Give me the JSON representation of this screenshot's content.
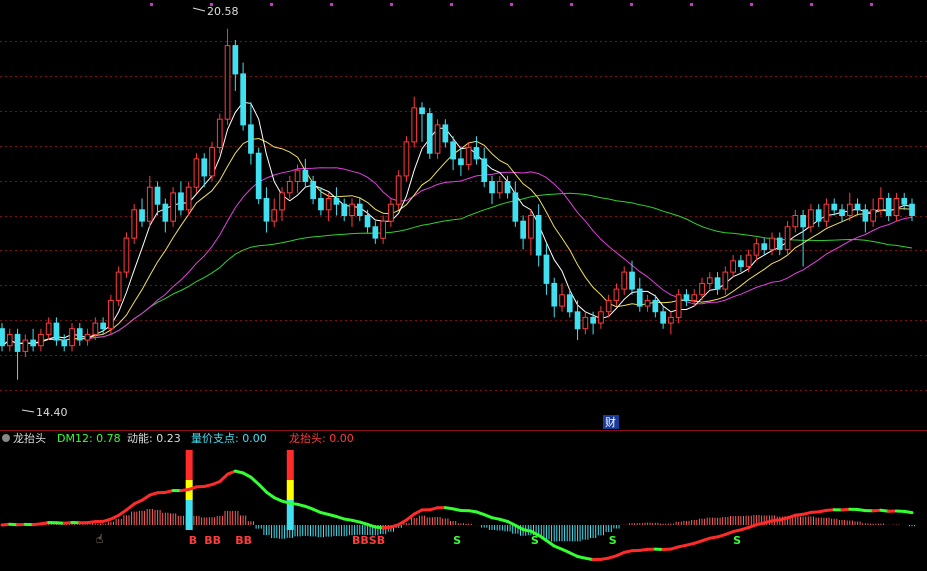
{
  "chart_data": [
    {
      "type": "candlestick",
      "price_range": [
        13.6,
        21.0
      ],
      "annotations": {
        "high_label": "20.58",
        "low_label": "14.40",
        "event_badge": "财"
      },
      "candles": [
        [
          15.3,
          15.0,
          15.4,
          14.9
        ],
        [
          15.0,
          15.2,
          15.3,
          14.9
        ],
        [
          15.2,
          14.9,
          15.3,
          14.4
        ],
        [
          14.9,
          15.1,
          15.2,
          14.8
        ],
        [
          15.1,
          15.0,
          15.3,
          14.9
        ],
        [
          15.0,
          15.2,
          15.3,
          14.9
        ],
        [
          15.2,
          15.4,
          15.5,
          15.1
        ],
        [
          15.4,
          15.1,
          15.5,
          15.0
        ],
        [
          15.1,
          15.0,
          15.2,
          14.9
        ],
        [
          15.0,
          15.3,
          15.4,
          14.9
        ],
        [
          15.3,
          15.1,
          15.4,
          15.0
        ],
        [
          15.1,
          15.2,
          15.3,
          15.0
        ],
        [
          15.2,
          15.4,
          15.5,
          15.1
        ],
        [
          15.4,
          15.3,
          15.5,
          15.2
        ],
        [
          15.3,
          15.8,
          15.9,
          15.2
        ],
        [
          15.8,
          16.3,
          16.4,
          15.7
        ],
        [
          16.3,
          16.9,
          17.0,
          16.2
        ],
        [
          16.9,
          17.4,
          17.5,
          16.8
        ],
        [
          17.4,
          17.2,
          17.6,
          17.1
        ],
        [
          17.2,
          17.8,
          18.0,
          17.1
        ],
        [
          17.8,
          17.5,
          17.9,
          17.3
        ],
        [
          17.5,
          17.2,
          17.6,
          17.0
        ],
        [
          17.2,
          17.7,
          17.8,
          17.1
        ],
        [
          17.7,
          17.4,
          17.9,
          17.3
        ],
        [
          17.4,
          17.8,
          17.9,
          17.3
        ],
        [
          17.8,
          18.3,
          18.4,
          17.7
        ],
        [
          18.3,
          18.0,
          18.4,
          17.8
        ],
        [
          18.0,
          18.5,
          18.6,
          17.9
        ],
        [
          18.5,
          19.0,
          19.1,
          18.4
        ],
        [
          19.0,
          20.3,
          20.6,
          18.9
        ],
        [
          20.3,
          19.8,
          20.4,
          19.5
        ],
        [
          19.8,
          18.9,
          20.0,
          18.8
        ],
        [
          18.9,
          18.4,
          19.3,
          18.2
        ],
        [
          18.4,
          17.6,
          18.5,
          17.5
        ],
        [
          17.6,
          17.2,
          17.8,
          17.0
        ],
        [
          17.2,
          17.4,
          17.6,
          17.1
        ],
        [
          17.4,
          17.7,
          17.8,
          17.2
        ],
        [
          17.7,
          17.9,
          18.0,
          17.6
        ],
        [
          17.9,
          18.1,
          18.2,
          17.7
        ],
        [
          18.1,
          17.9,
          18.3,
          17.8
        ],
        [
          17.9,
          17.6,
          18.0,
          17.5
        ],
        [
          17.6,
          17.4,
          17.8,
          17.3
        ],
        [
          17.4,
          17.6,
          17.7,
          17.2
        ],
        [
          17.6,
          17.5,
          17.8,
          17.3
        ],
        [
          17.5,
          17.3,
          17.6,
          17.2
        ],
        [
          17.3,
          17.5,
          17.6,
          17.1
        ],
        [
          17.5,
          17.3,
          17.6,
          17.2
        ],
        [
          17.3,
          17.1,
          17.4,
          17.0
        ],
        [
          17.1,
          16.9,
          17.2,
          16.8
        ],
        [
          16.9,
          17.2,
          17.3,
          16.8
        ],
        [
          17.2,
          17.5,
          17.6,
          17.1
        ],
        [
          17.5,
          18.0,
          18.1,
          17.4
        ],
        [
          18.0,
          18.6,
          18.7,
          17.9
        ],
        [
          18.6,
          19.2,
          19.4,
          18.5
        ],
        [
          19.2,
          19.1,
          19.3,
          18.6
        ],
        [
          19.1,
          18.4,
          19.2,
          18.3
        ],
        [
          18.4,
          18.9,
          19.0,
          18.3
        ],
        [
          18.9,
          18.6,
          19.0,
          18.5
        ],
        [
          18.6,
          18.3,
          18.7,
          18.1
        ],
        [
          18.3,
          18.2,
          18.5,
          18.0
        ],
        [
          18.2,
          18.5,
          18.6,
          18.1
        ],
        [
          18.5,
          18.3,
          18.7,
          18.2
        ],
        [
          18.3,
          17.9,
          18.5,
          17.8
        ],
        [
          17.9,
          17.7,
          18.0,
          17.5
        ],
        [
          17.7,
          17.9,
          18.0,
          17.6
        ],
        [
          17.9,
          17.7,
          18.0,
          17.6
        ],
        [
          17.7,
          17.2,
          17.9,
          17.1
        ],
        [
          17.2,
          16.9,
          17.3,
          16.7
        ],
        [
          16.9,
          17.3,
          17.4,
          16.6
        ],
        [
          17.3,
          16.6,
          17.5,
          16.4
        ],
        [
          16.6,
          16.1,
          16.8,
          15.9
        ],
        [
          16.1,
          15.7,
          16.2,
          15.5
        ],
        [
          15.7,
          15.9,
          16.1,
          15.6
        ],
        [
          15.9,
          15.6,
          16.0,
          15.5
        ],
        [
          15.6,
          15.3,
          15.8,
          15.1
        ],
        [
          15.3,
          15.5,
          15.6,
          15.2
        ],
        [
          15.5,
          15.4,
          15.6,
          15.2
        ],
        [
          15.4,
          15.6,
          15.7,
          15.3
        ],
        [
          15.6,
          15.8,
          15.9,
          15.5
        ],
        [
          15.8,
          16.0,
          16.1,
          15.7
        ],
        [
          16.0,
          16.3,
          16.4,
          15.9
        ],
        [
          16.3,
          16.0,
          16.5,
          15.9
        ],
        [
          16.0,
          15.7,
          16.2,
          15.6
        ],
        [
          15.7,
          15.8,
          15.9,
          15.6
        ],
        [
          15.8,
          15.6,
          15.9,
          15.5
        ],
        [
          15.6,
          15.4,
          15.7,
          15.3
        ],
        [
          15.4,
          15.5,
          15.6,
          15.2
        ],
        [
          15.5,
          15.9,
          16.0,
          15.4
        ],
        [
          15.9,
          15.8,
          16.0,
          15.7
        ],
        [
          15.8,
          15.9,
          16.0,
          15.7
        ],
        [
          15.9,
          16.1,
          16.2,
          15.8
        ],
        [
          16.1,
          16.2,
          16.3,
          16.0
        ],
        [
          16.2,
          16.0,
          16.3,
          15.9
        ],
        [
          16.0,
          16.3,
          16.4,
          15.9
        ],
        [
          16.3,
          16.5,
          16.6,
          16.2
        ],
        [
          16.5,
          16.4,
          16.6,
          16.3
        ],
        [
          16.4,
          16.6,
          16.7,
          16.3
        ],
        [
          16.6,
          16.8,
          16.9,
          16.5
        ],
        [
          16.8,
          16.7,
          16.9,
          16.6
        ],
        [
          16.7,
          16.9,
          17.0,
          16.6
        ],
        [
          16.9,
          16.7,
          17.0,
          16.6
        ],
        [
          16.7,
          17.1,
          17.2,
          16.6
        ],
        [
          17.1,
          17.3,
          17.4,
          17.0
        ],
        [
          17.3,
          17.1,
          17.4,
          16.4
        ],
        [
          17.1,
          17.4,
          17.5,
          17.0
        ],
        [
          17.4,
          17.2,
          17.5,
          17.1
        ],
        [
          17.2,
          17.5,
          17.6,
          17.1
        ],
        [
          17.5,
          17.4,
          17.6,
          17.3
        ],
        [
          17.4,
          17.3,
          17.5,
          17.2
        ],
        [
          17.3,
          17.5,
          17.7,
          17.2
        ],
        [
          17.5,
          17.4,
          17.6,
          17.3
        ],
        [
          17.4,
          17.2,
          17.5,
          17.0
        ],
        [
          17.2,
          17.4,
          17.6,
          17.1
        ],
        [
          17.4,
          17.6,
          17.8,
          17.3
        ],
        [
          17.6,
          17.3,
          17.7,
          17.2
        ],
        [
          17.3,
          17.6,
          17.7,
          17.2
        ],
        [
          17.6,
          17.5,
          17.7,
          17.4
        ],
        [
          17.5,
          17.3,
          17.6,
          17.2
        ]
      ],
      "moving_average_colors": {
        "ma5": "#ffffff",
        "ma10": "#f0e060",
        "ma20": "#e040e0",
        "ma60": "#30d030"
      },
      "colors": {
        "up": "#ff3b3b",
        "down": "#40e0f0",
        "grid": "#7a1010",
        "background": "#000000"
      }
    },
    {
      "type": "indicator",
      "header": {
        "name": "龙抬头",
        "items": [
          {
            "label": "DM12: 0.78",
            "color": "#33ff33"
          },
          {
            "label": "动能: 0.23",
            "color": "#dddddd"
          },
          {
            "label": "量价支点: 0.00",
            "color": "#40e0f0"
          },
          {
            "label": "龙抬头: 0.00",
            "color": "#ff3b3b"
          }
        ]
      },
      "signals": [
        {
          "index": 24,
          "text": "B",
          "color": "#ff3b3b"
        },
        {
          "index": 26,
          "text": "BB",
          "color": "#ff3b3b"
        },
        {
          "index": 30,
          "text": "BB",
          "color": "#ff3b3b"
        },
        {
          "index": 45,
          "text": "BBSB",
          "color": "#ff3b3b"
        },
        {
          "index": 58,
          "text": "S",
          "color": "#33ff33"
        },
        {
          "index": 68,
          "text": "S",
          "color": "#33ff33"
        },
        {
          "index": 78,
          "text": "S",
          "color": "#33ff33"
        },
        {
          "index": 94,
          "text": "S",
          "color": "#33ff33"
        }
      ],
      "colors": {
        "rising": "#ff2a2a",
        "falling": "#33ff33",
        "hist_pos": "#ff6060",
        "hist_neg": "#40e0f0",
        "bar_top": "#ff2a2a",
        "bar_mid": "#ffff00",
        "bar_low": "#40e0f0"
      }
    }
  ]
}
